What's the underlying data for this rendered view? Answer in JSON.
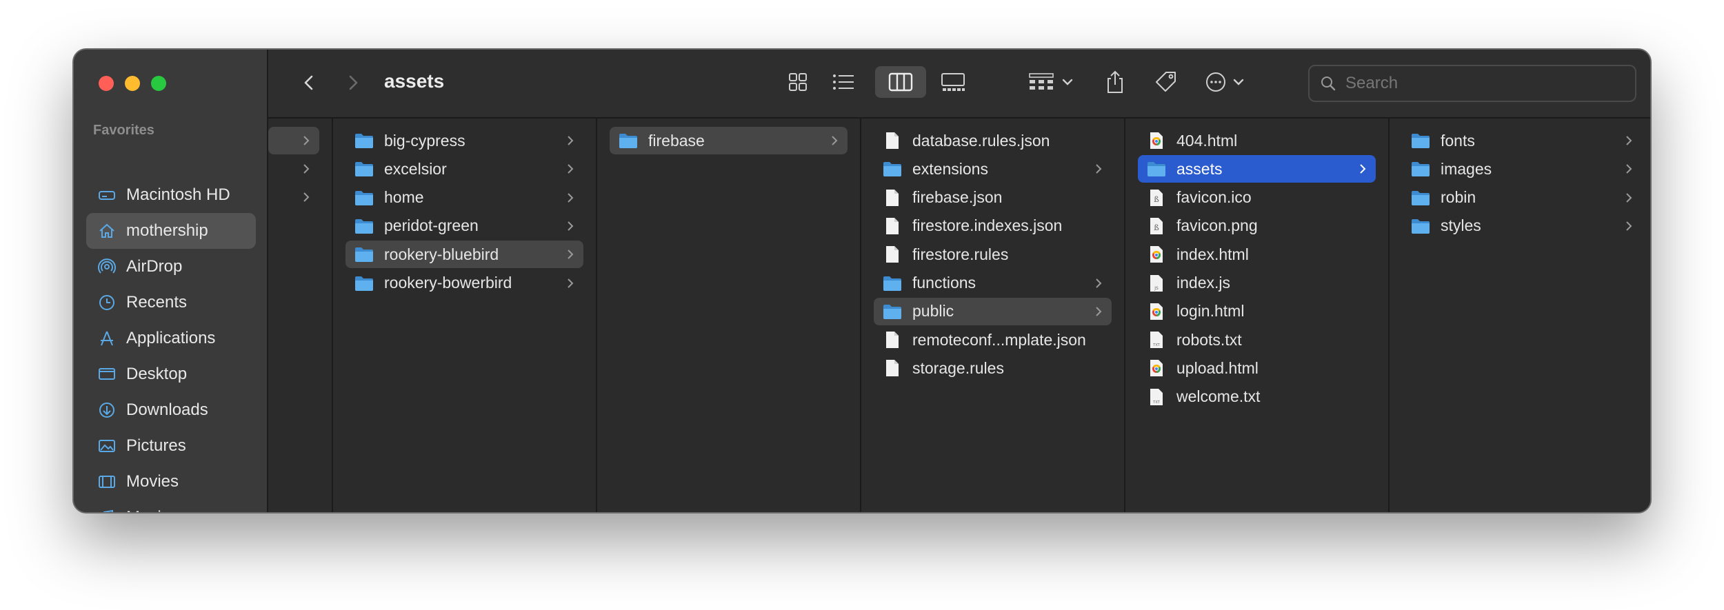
{
  "window": {
    "title": "assets"
  },
  "sidebar": {
    "section": "Favorites",
    "items": [
      {
        "label": "Macintosh HD",
        "icon": "hard-drive-icon"
      },
      {
        "label": "mothership",
        "icon": "home-icon"
      },
      {
        "label": "AirDrop",
        "icon": "airdrop-icon"
      },
      {
        "label": "Recents",
        "icon": "clock-icon"
      },
      {
        "label": "Applications",
        "icon": "applications-icon"
      },
      {
        "label": "Desktop",
        "icon": "desktop-icon"
      },
      {
        "label": "Downloads",
        "icon": "download-icon"
      },
      {
        "label": "Pictures",
        "icon": "pictures-icon"
      },
      {
        "label": "Movies",
        "icon": "movies-icon"
      },
      {
        "label": "Music",
        "icon": "music-icon"
      }
    ]
  },
  "search": {
    "placeholder": "Search"
  },
  "columns": {
    "col2": [
      "big-cypress",
      "excelsior",
      "home",
      "peridot-green",
      "rookery-bluebird",
      "rookery-bowerbird"
    ],
    "col3": [
      "firebase"
    ],
    "col4": [
      "database.rules.json",
      "extensions",
      "firebase.json",
      "firestore.indexes.json",
      "firestore.rules",
      "functions",
      "public",
      "remoteconf...mplate.json",
      "storage.rules"
    ],
    "col5": [
      "404.html",
      "assets",
      "favicon.ico",
      "favicon.png",
      "index.html",
      "index.js",
      "login.html",
      "robots.txt",
      "upload.html",
      "welcome.txt"
    ],
    "col6": [
      "fonts",
      "images",
      "robin",
      "styles"
    ]
  },
  "colors": {
    "accent": "#2a5ccf",
    "folder": "#5aa9e6"
  }
}
